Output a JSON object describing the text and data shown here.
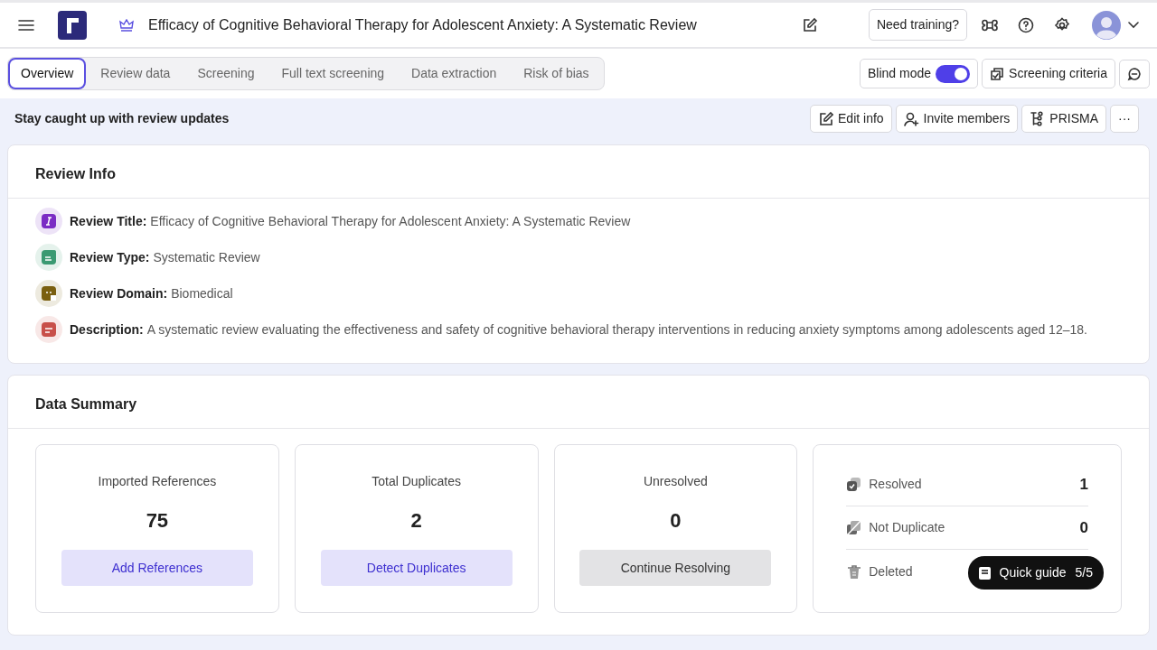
{
  "header": {
    "title": "Efficacy of Cognitive Behavioral Therapy for Adolescent Anxiety: A Systematic Review",
    "training": "Need training?"
  },
  "tabs": [
    {
      "label": "Overview",
      "selected": true
    },
    {
      "label": "Review data",
      "selected": false
    },
    {
      "label": "Screening",
      "selected": false
    },
    {
      "label": "Full text screening",
      "selected": false
    },
    {
      "label": "Data extraction",
      "selected": false
    },
    {
      "label": "Risk of bias",
      "selected": false
    }
  ],
  "blind_mode": {
    "label": "Blind mode",
    "on": true
  },
  "screening_criteria": "Screening criteria",
  "notice": "Stay caught up with review updates",
  "actions": [
    {
      "kind": "edit",
      "label": "Edit info"
    },
    {
      "kind": "invite",
      "label": "Invite members"
    },
    {
      "kind": "prisma",
      "label": "PRISMA"
    },
    {
      "kind": "more",
      "label": "···"
    }
  ],
  "review_info": {
    "heading": "Review Info",
    "items": [
      {
        "kind": "title",
        "color": "#7b2cc4",
        "label": "Review Title:",
        "value": "Efficacy of Cognitive Behavioral Therapy for Adolescent Anxiety: A Systematic Review"
      },
      {
        "kind": "type",
        "color": "#3a9a72",
        "label": "Review Type:",
        "value": "Systematic Review"
      },
      {
        "kind": "domain",
        "color": "#7a5f10",
        "label": "Review Domain:",
        "value": "Biomedical"
      },
      {
        "kind": "description",
        "color": "#c8504a",
        "label": "Description:",
        "value": "A systematic review evaluating the effectiveness and safety of cognitive behavioral therapy interventions in reducing anxiety symptoms among adolescents aged 12–18."
      }
    ]
  },
  "data_summary": {
    "heading": "Data Summary",
    "cards": [
      {
        "label": "Imported References",
        "value": "75",
        "button": "Add References",
        "kind": "accent"
      },
      {
        "label": "Total Duplicates",
        "value": "2",
        "button": "Detect Duplicates",
        "kind": "accent"
      },
      {
        "label": "Unresolved",
        "value": "0",
        "button": "Continue Resolving",
        "kind": "neutral"
      }
    ],
    "stats": [
      {
        "kind": "resolved",
        "label": "Resolved",
        "value": "1"
      },
      {
        "kind": "not_duplicate",
        "label": "Not Duplicate",
        "value": "0"
      },
      {
        "kind": "deleted",
        "label": "Deleted"
      }
    ]
  },
  "quick_guide": {
    "label": "Quick guide",
    "step": "5/5"
  }
}
